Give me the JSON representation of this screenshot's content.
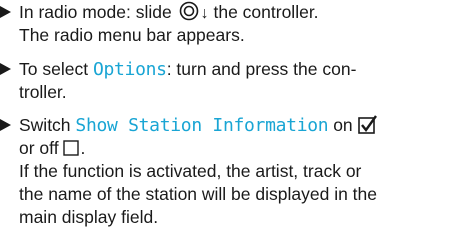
{
  "colors": {
    "text": "#1a1a1a",
    "highlight": "#19a5d4"
  },
  "steps": [
    {
      "line1_pre": "In radio mode: slide",
      "line1_icon": "controller-icon",
      "line1_arrow": "↓",
      "line1_post": "the controller.",
      "line2": "The radio menu bar appears."
    },
    {
      "line1_pre": "To select",
      "line1_highlight": "Options",
      "line1_post": ": turn and press the con-",
      "line2": "troller."
    },
    {
      "line1_pre": "Switch",
      "line1_highlight": "Show Station Information",
      "line1_post": "on",
      "line1_icon": "checkbox-checked-icon",
      "line2_pre": "or off",
      "line2_icon": "checkbox-unchecked-icon",
      "line2_post": ".",
      "line3": "If the function is activated, the artist, track or",
      "line4": "the name of the station will be displayed in the",
      "line5": "main display field."
    }
  ]
}
